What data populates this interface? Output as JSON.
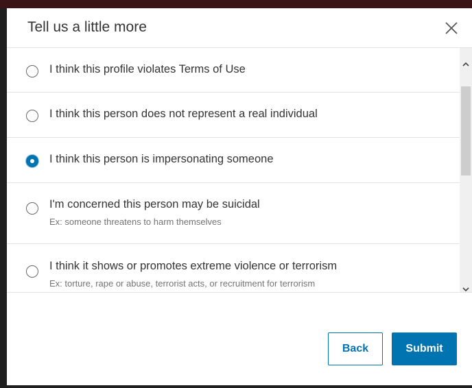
{
  "modal": {
    "title": "Tell us a little more",
    "close_icon": "close-icon"
  },
  "options": [
    {
      "label": "I think this profile violates Terms of Use",
      "description": "",
      "selected": false
    },
    {
      "label": "I think this person does not represent a real individual",
      "description": "",
      "selected": false
    },
    {
      "label": "I think this person is impersonating someone",
      "description": "",
      "selected": true
    },
    {
      "label": "I'm concerned this person may be suicidal",
      "description": "Ex: someone threatens to harm themselves",
      "selected": false
    },
    {
      "label": "I think it shows or promotes extreme violence or terrorism",
      "description": "Ex: torture, rape or abuse, terrorist acts, or recruitment for terrorism",
      "selected": false
    }
  ],
  "buttons": {
    "back_label": "Back",
    "submit_label": "Submit"
  },
  "colors": {
    "accent": "#0073b1",
    "text": "#333333",
    "muted": "#737373",
    "divider": "#e1e1e1"
  }
}
